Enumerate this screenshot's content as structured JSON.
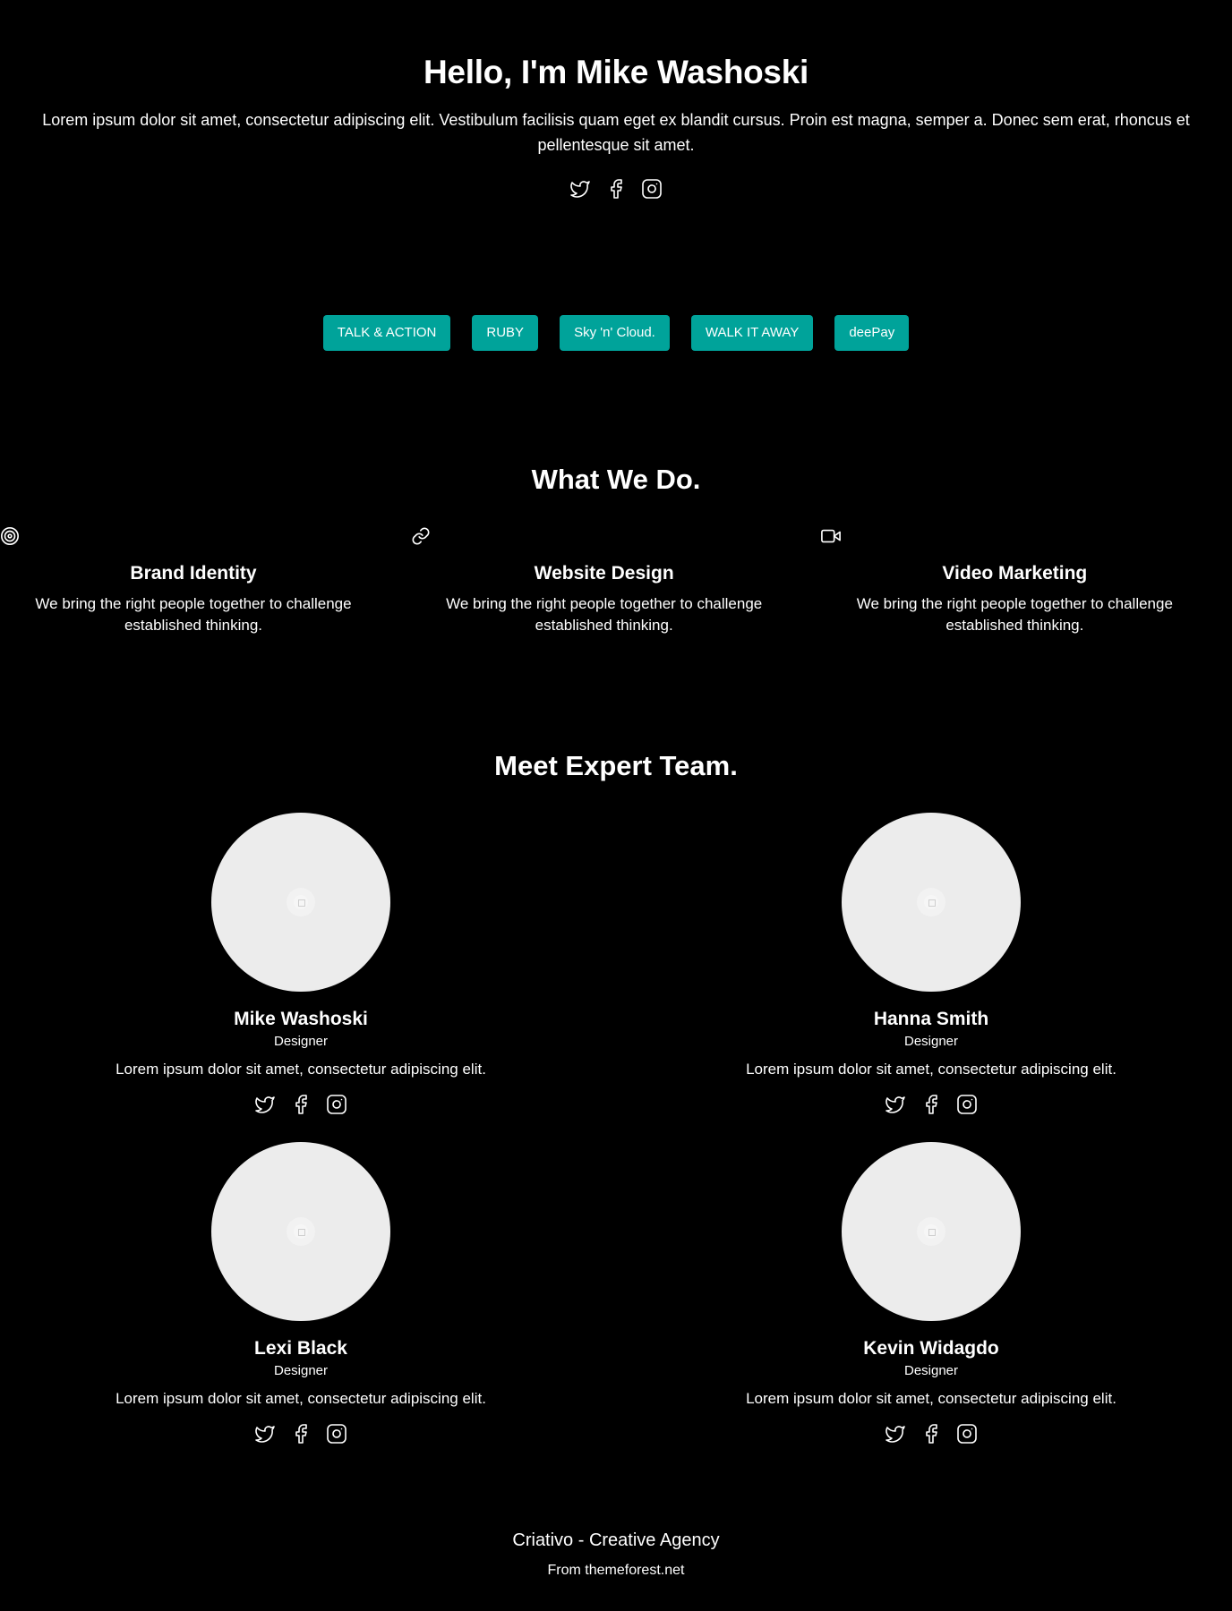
{
  "hero": {
    "title": "Hello, I'm Mike Washoski",
    "text": "Lorem ipsum dolor sit amet, consectetur adipiscing elit. Vestibulum facilisis quam eget ex blandit cursus. Proin est magna, semper a. Donec sem erat, rhoncus et pellentesque sit amet.",
    "social_icons": [
      "twitter-icon",
      "facebook-icon",
      "instagram-icon"
    ]
  },
  "tags": [
    "TALK & ACTION",
    "RUBY",
    "Sky 'n' Cloud.",
    "WALK IT AWAY",
    "deePay"
  ],
  "services": {
    "title": "What We Do.",
    "items": [
      {
        "icon": "target-icon",
        "title": "Brand Identity",
        "text": "We bring the right people together to challenge established thinking."
      },
      {
        "icon": "link-icon",
        "title": "Website Design",
        "text": "We bring the right people together to challenge established thinking."
      },
      {
        "icon": "video-icon",
        "title": "Video Marketing",
        "text": "We bring the right people together to challenge established thinking."
      }
    ]
  },
  "team": {
    "title": "Meet Expert Team.",
    "members": [
      {
        "name": "Mike Washoski",
        "role": "Designer",
        "bio": "Lorem ipsum dolor sit amet, consectetur adipiscing elit."
      },
      {
        "name": "Hanna Smith",
        "role": "Designer",
        "bio": "Lorem ipsum dolor sit amet, consectetur adipiscing elit."
      },
      {
        "name": "Lexi Black",
        "role": "Designer",
        "bio": "Lorem ipsum dolor sit amet, consectetur adipiscing elit."
      },
      {
        "name": "Kevin Widagdo",
        "role": "Designer",
        "bio": "Lorem ipsum dolor sit amet, consectetur adipiscing elit."
      }
    ]
  },
  "footer": {
    "title": "Criativo - Creative Agency",
    "sub": "From themeforest.net"
  },
  "colors": {
    "background": "#000000",
    "accent": "#00a39a",
    "text": "#ffffff",
    "avatar_placeholder": "#ececec"
  }
}
